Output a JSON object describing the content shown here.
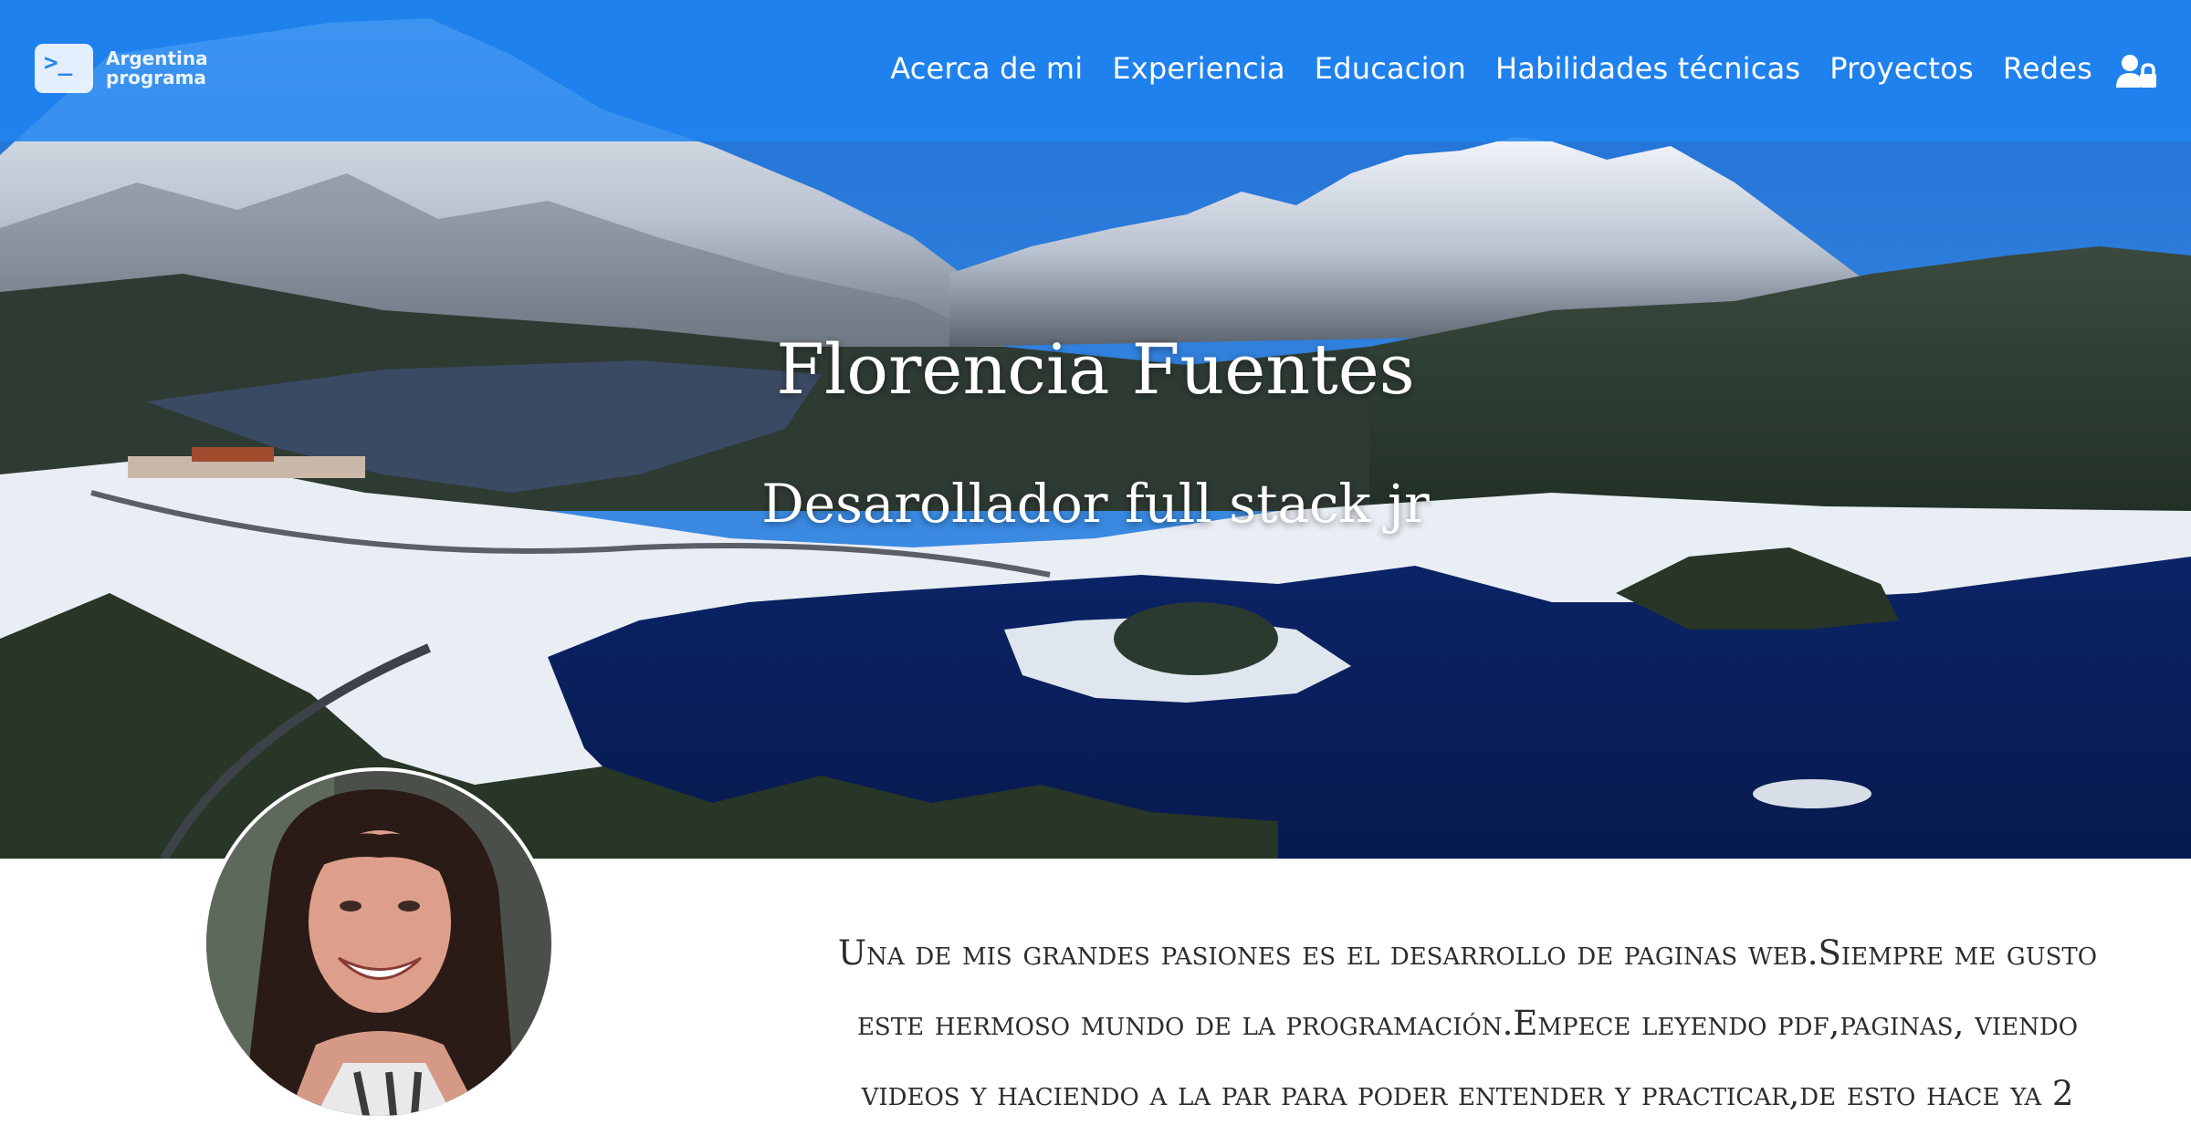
{
  "brand": {
    "line1": "Argentina",
    "line2": "programa",
    "icon": "terminal-prompt-icon"
  },
  "nav": {
    "items": [
      {
        "label": "Acerca de mi"
      },
      {
        "label": "Experiencia"
      },
      {
        "label": "Educacion"
      },
      {
        "label": "Habilidades técnicas"
      },
      {
        "label": "Proyectos"
      },
      {
        "label": "Redes"
      }
    ],
    "login_icon": "user-lock-icon"
  },
  "hero": {
    "name": "Florencia Fuentes",
    "role": "Desarollador full stack jr"
  },
  "about": {
    "text": "Una de mis grandes pasiones es el desarrollo de paginas web.Siempre me gusto este hermoso mundo de la programación.Empece leyendo pdf,paginas, viendo videos y haciendo a la par para poder entender y practicar,de esto hace ya 2"
  },
  "colors": {
    "navbar": "#1e84f0",
    "text": "#2c2c2c"
  }
}
